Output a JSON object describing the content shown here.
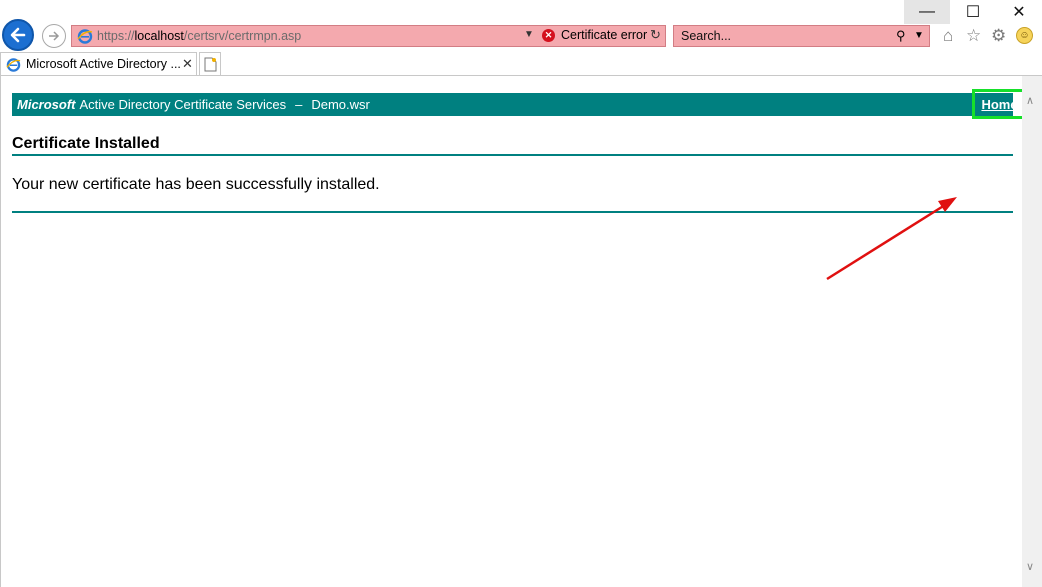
{
  "window": {
    "minimize_glyph": "—",
    "maximize_glyph": "☐",
    "close_glyph": "✕"
  },
  "address_bar": {
    "url_scheme": "https://",
    "url_host": "localhost",
    "url_path": "/certsrv/certrmpn.asp",
    "cert_error_label": "Certificate error",
    "background_color": "#f4a9ae"
  },
  "search": {
    "placeholder": "Search..."
  },
  "tabs": [
    {
      "title": "Microsoft Active Directory ..."
    }
  ],
  "page": {
    "banner": {
      "brand": "Microsoft",
      "service": "Active Directory Certificate Services",
      "separator": "–",
      "server": "Demo.wsr",
      "home_link": "Home",
      "color": "#008080"
    },
    "heading": "Certificate Installed",
    "message": "Your new certificate has been successfully installed."
  },
  "annotations": {
    "highlight_color": "#16e02a",
    "arrow_color": "#e01010"
  }
}
